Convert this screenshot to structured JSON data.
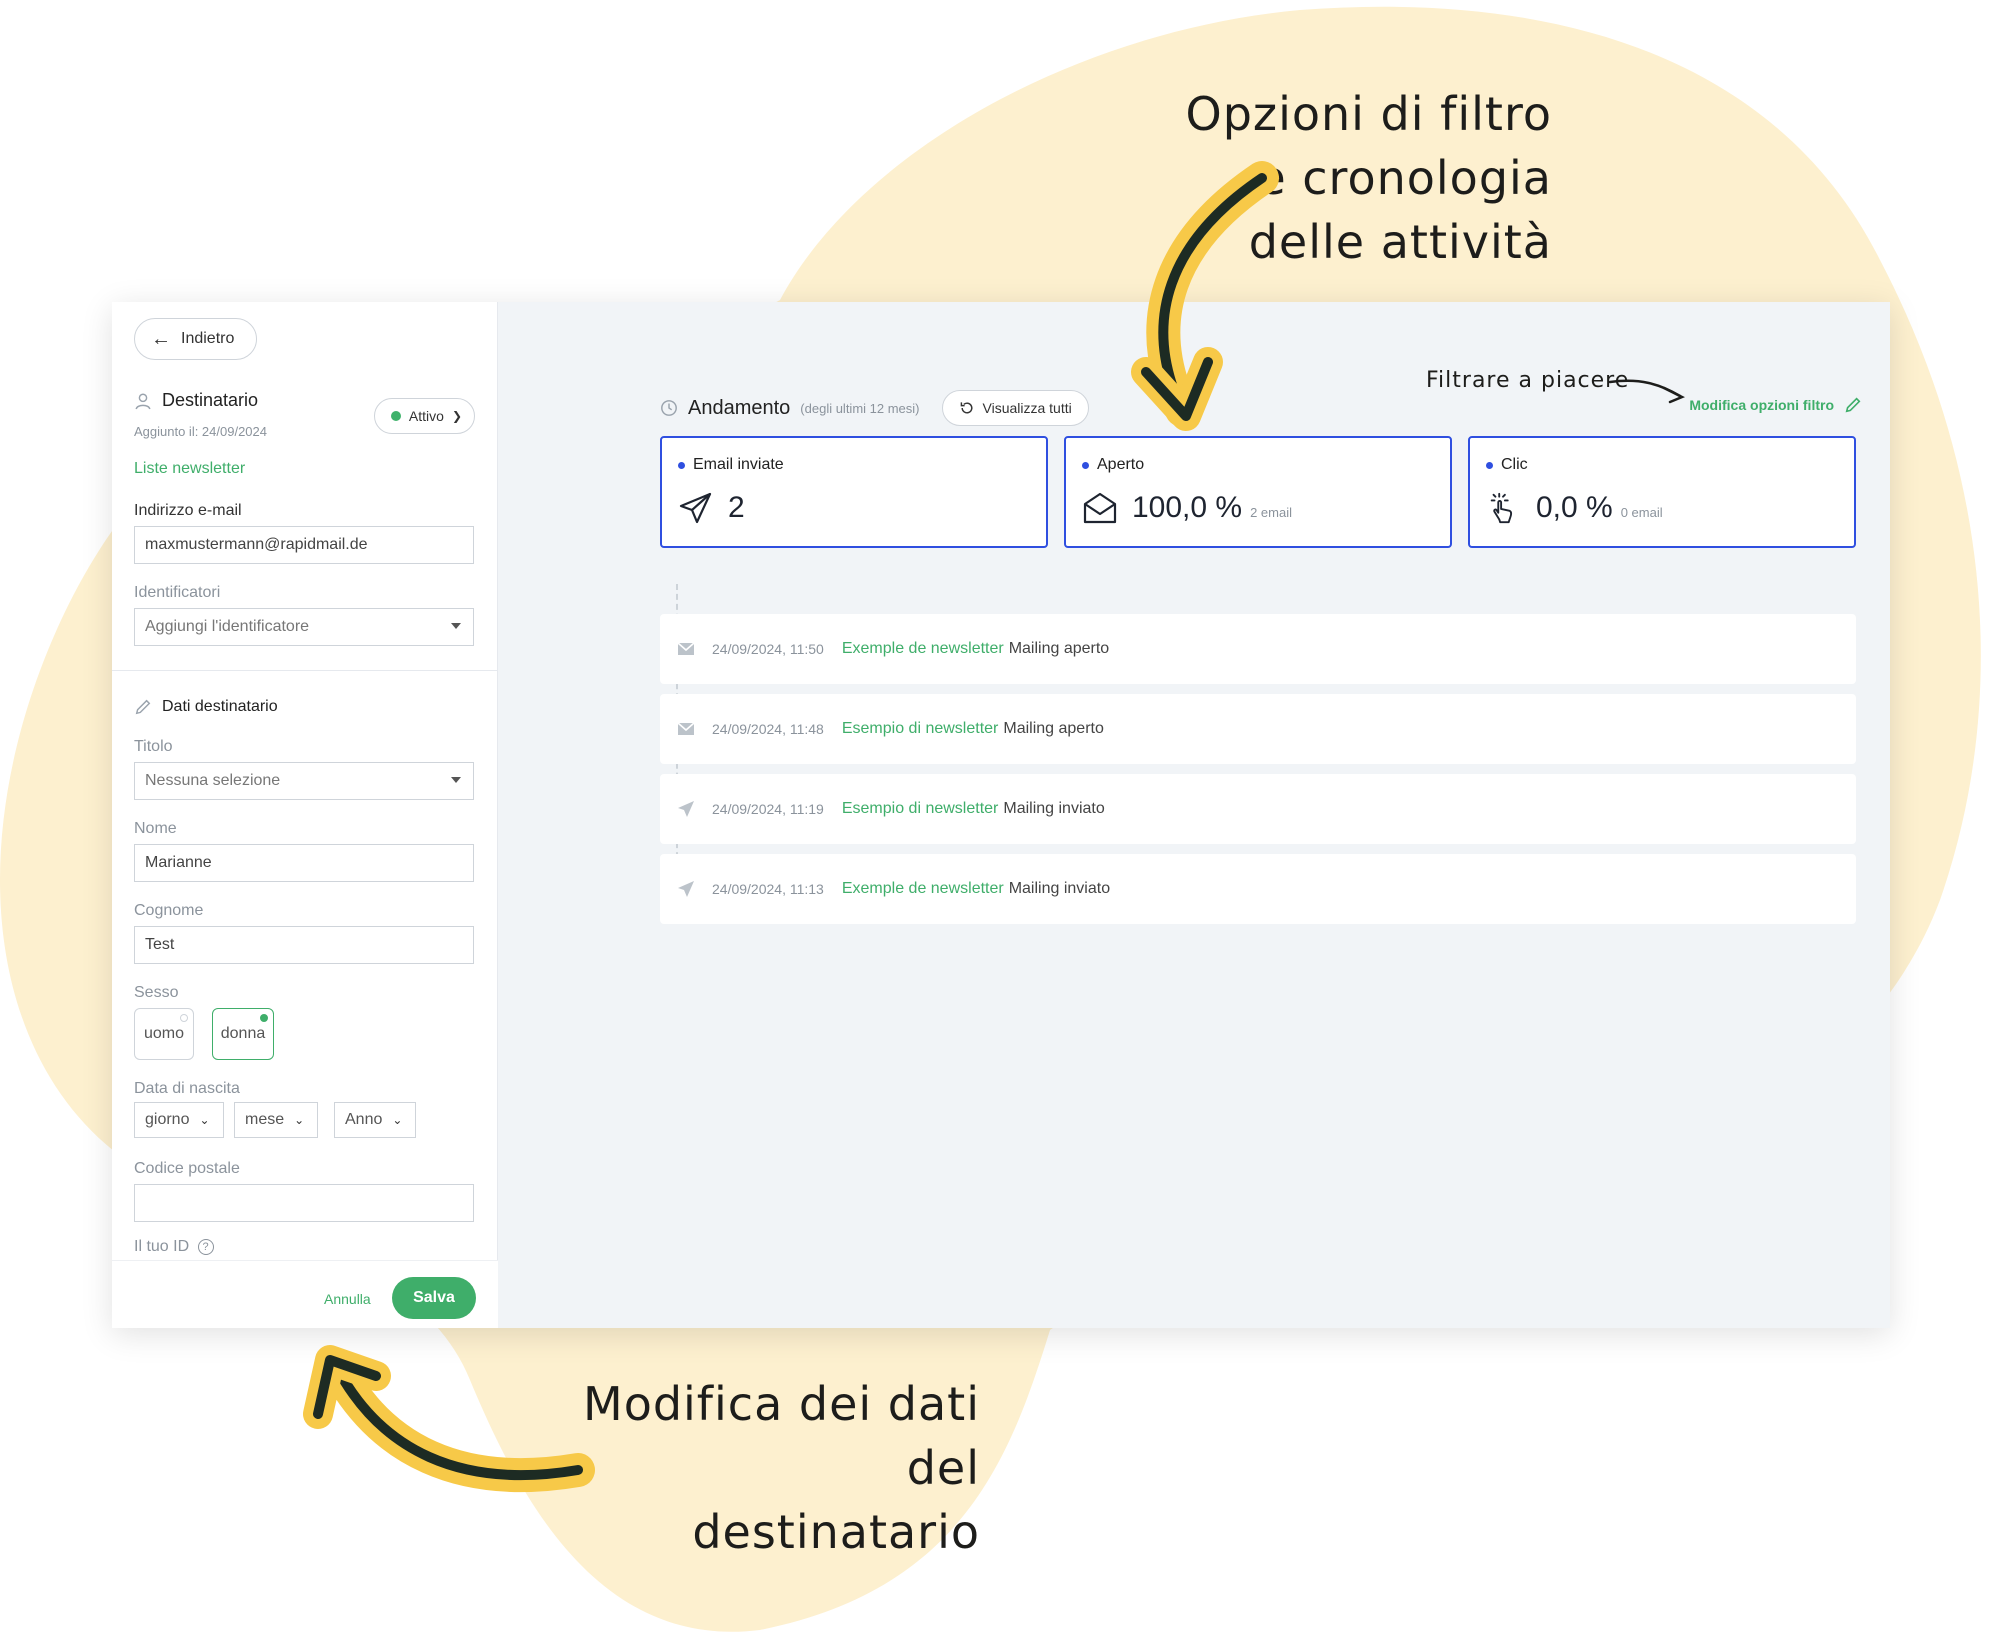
{
  "annotations": {
    "filter_note_lines": [
      "Opzioni di filtro",
      "e cronologia",
      "delle attività"
    ],
    "edit_note_lines": [
      "Modifica dei dati del",
      "destinatario"
    ],
    "small_note": "Filtrare a piacere"
  },
  "colors": {
    "accent_green": "#3fae6a",
    "card_border_blue": "#2f4fe0",
    "blob_yellow": "#fdf0cf",
    "arrow_yellow": "#f7c948",
    "arrow_dark": "#1d2b23"
  },
  "sidebar": {
    "back_label": "Indietro",
    "recipient_title": "Destinatario",
    "added_text": "Aggiunto il: 24/09/2024",
    "status": "Attivo",
    "newsletter_lists_link": "Liste newsletter",
    "email_label": "Indirizzo e-mail",
    "email_value": "maxmustermann@rapidmail.de",
    "identifiers_label": "Identificatori",
    "identifiers_placeholder": "Aggiungi l'identificatore",
    "recipient_data_title": "Dati destinatario",
    "title_label": "Titolo",
    "title_value": "Nessuna selezione",
    "first_name_label": "Nome",
    "first_name_value": "Marianne",
    "last_name_label": "Cognome",
    "last_name_value": "Test",
    "gender_label": "Sesso",
    "gender_options": [
      "uomo",
      "donna"
    ],
    "birth_label": "Data di nascita",
    "birth_day": "giorno",
    "birth_month": "mese",
    "birth_year": "Anno",
    "zip_label": "Codice postale",
    "zip_value": "",
    "your_id_label": "Il tuo ID",
    "cancel_label": "Annulla",
    "save_label": "Salva"
  },
  "main": {
    "perf_title": "Andamento",
    "perf_subtitle": "(degli ultimi 12 mesi)",
    "view_all_label": "Visualizza tutti",
    "filter_link": "Modifica opzioni filtro",
    "stats": [
      {
        "label": "Email inviate",
        "value": "2",
        "extra": "",
        "icon": "paper-plane-icon"
      },
      {
        "label": "Aperto",
        "value": "100,0 %",
        "extra": "2 email",
        "icon": "envelope-open-icon"
      },
      {
        "label": "Clic",
        "value": "0,0 %",
        "extra": "0 email",
        "icon": "pointer-click-icon"
      }
    ],
    "events": [
      {
        "time": "24/09/2024, 11:50",
        "name": "Exemple de newsletter",
        "action": "Mailing aperto",
        "icon": "envelope-icon"
      },
      {
        "time": "24/09/2024, 11:48",
        "name": "Esempio di newsletter",
        "action": "Mailing aperto",
        "icon": "envelope-icon"
      },
      {
        "time": "24/09/2024, 11:19",
        "name": "Esempio di newsletter",
        "action": "Mailing inviato",
        "icon": "paper-plane-icon"
      },
      {
        "time": "24/09/2024, 11:13",
        "name": "Exemple de newsletter",
        "action": "Mailing inviato",
        "icon": "paper-plane-icon"
      }
    ]
  }
}
